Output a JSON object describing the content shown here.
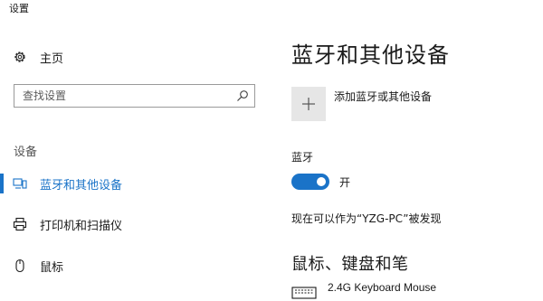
{
  "window": {
    "title": "设置"
  },
  "sidebar": {
    "home_label": "主页",
    "search_placeholder": "查找设置",
    "section_label": "设备",
    "items": [
      {
        "label": "蓝牙和其他设备",
        "icon": "bluetooth-devices-icon",
        "selected": true
      },
      {
        "label": "打印机和扫描仪",
        "icon": "printer-icon",
        "selected": false
      },
      {
        "label": "鼠标",
        "icon": "mouse-icon",
        "selected": false
      }
    ]
  },
  "main": {
    "title": "蓝牙和其他设备",
    "add_device_label": "添加蓝牙或其他设备",
    "bluetooth_label": "蓝牙",
    "bluetooth_toggle": {
      "on": true,
      "state_label": "开"
    },
    "discoverable_text": "现在可以作为“YZG-PC”被发现",
    "section_heading": "鼠标、键盘和笔",
    "devices": [
      {
        "name": "2.4G Keyboard Mouse",
        "icon": "keyboard-icon"
      }
    ]
  },
  "colors": {
    "accent": "#1a73c8",
    "add_tile": "#e6e6e6"
  }
}
